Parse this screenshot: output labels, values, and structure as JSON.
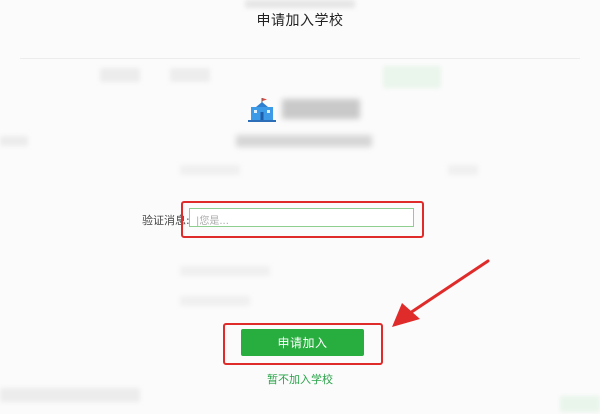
{
  "dialog": {
    "title": "申请加入学校",
    "verify_label": "验证消息:",
    "input_placeholder": "|您是...",
    "apply_button": "申请加入",
    "skip_link": "暂不加入学校"
  },
  "colors": {
    "accent_green": "#27ae3e",
    "annotation_red": "#e02b2b"
  },
  "icons": {
    "school": "school-building-icon",
    "arrow": "red-arrow-annotation"
  }
}
